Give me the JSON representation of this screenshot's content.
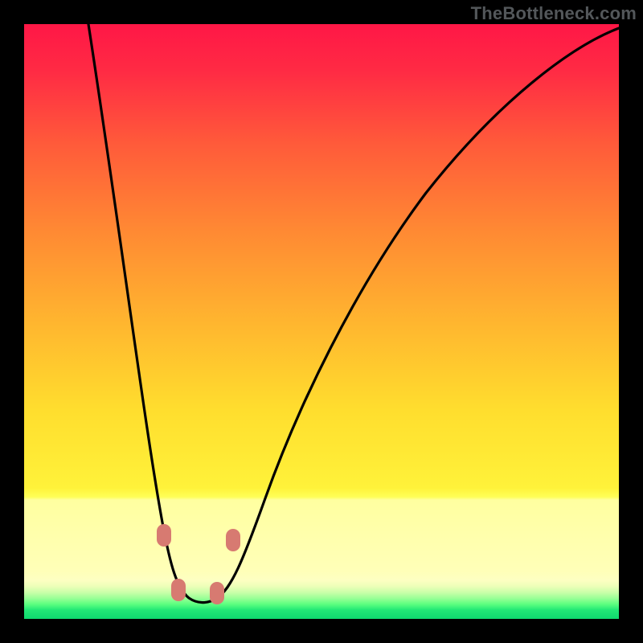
{
  "watermark": "TheBottleneck.com",
  "colors": {
    "frame_background": "#000000",
    "curve_stroke": "#000000",
    "marker_fill": "#d77a71",
    "gradient_stops": [
      {
        "t": 0.0,
        "c": "#ff1746"
      },
      {
        "t": 0.08,
        "c": "#ff2b44"
      },
      {
        "t": 0.2,
        "c": "#ff5a3a"
      },
      {
        "t": 0.35,
        "c": "#ff8a33"
      },
      {
        "t": 0.5,
        "c": "#ffb52f"
      },
      {
        "t": 0.65,
        "c": "#ffde2e"
      },
      {
        "t": 0.78,
        "c": "#fff23a"
      },
      {
        "t": 0.795,
        "c": "#ffff57"
      },
      {
        "t": 0.8,
        "c": "#ffffa0"
      },
      {
        "t": 0.92,
        "c": "#ffffb8"
      },
      {
        "t": 0.935,
        "c": "#fdffc2"
      },
      {
        "t": 0.945,
        "c": "#edffb8"
      },
      {
        "t": 0.955,
        "c": "#ccffaa"
      },
      {
        "t": 0.965,
        "c": "#9bff97"
      },
      {
        "t": 0.975,
        "c": "#5eff80"
      },
      {
        "t": 0.985,
        "c": "#22e876"
      },
      {
        "t": 1.0,
        "c": "#0fd86f"
      }
    ]
  },
  "chart_data": {
    "type": "line",
    "title": "",
    "xlabel": "",
    "ylabel": "",
    "xlim": [
      0,
      100
    ],
    "ylim": [
      0,
      100
    ],
    "note": "V-shaped bottleneck curve on a vertical bottleneck-severity heat gradient (red=high at top → green=low at bottom). Axes are unlabeled percentages; values estimated from pixel positions.",
    "series": [
      {
        "name": "bottleneck",
        "x": [
          11,
          15,
          20,
          23,
          26,
          28,
          30,
          32,
          35,
          41,
          50,
          60,
          70,
          80,
          90,
          100
        ],
        "y": [
          100,
          66,
          36,
          19,
          8,
          3,
          2,
          3,
          10,
          21,
          38,
          55,
          70,
          84,
          94,
          99
        ]
      }
    ],
    "markers": [
      {
        "name": "left-upper",
        "x": 23.5,
        "y": 14
      },
      {
        "name": "left-lower",
        "x": 26.0,
        "y": 5
      },
      {
        "name": "right-lower",
        "x": 32.5,
        "y": 4
      },
      {
        "name": "right-upper",
        "x": 35.0,
        "y": 13
      }
    ]
  }
}
